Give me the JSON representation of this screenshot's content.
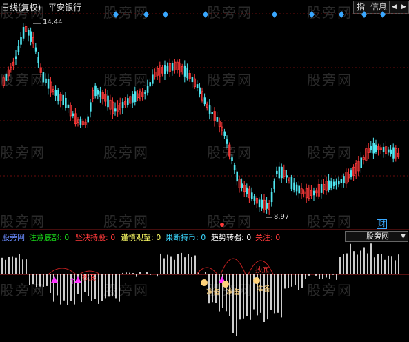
{
  "header": {
    "period": "日线(复权)",
    "stock": "平安银行",
    "btn_index": "指",
    "btn_info": "信息",
    "btn_prev": "◀",
    "btn_next": "▶"
  },
  "price_chart": {
    "high_label": "14.44",
    "low_label": "8.97",
    "finance_badge": "财"
  },
  "indicator_bar": {
    "source": "股旁网",
    "items": [
      {
        "label": "注意底部",
        "value": "0",
        "color": "#19d819"
      },
      {
        "label": "坚决持股",
        "value": "0",
        "color": "#ff3a3a"
      },
      {
        "label": "谨慎观望",
        "value": "0",
        "color": "#ffff66"
      },
      {
        "label": "果断持币",
        "value": "0",
        "color": "#3ad8ff"
      },
      {
        "label": "趋势转强",
        "value": "0",
        "color": "#ffffff"
      },
      {
        "label": "关注",
        "value": "0",
        "color": "#ff3a3a"
      }
    ],
    "dropdown": "股旁网"
  },
  "signals": {
    "label_zhundi": "抄底",
    "label_zhunbei": "准备",
    "label_up": "↑"
  },
  "watermark": "股旁网",
  "colors": {
    "up": "#ff3a3a",
    "down": "#4fe6f0",
    "signal_diamond": "#3aa8ff",
    "magenta": "#ff33ff",
    "gold": "#ffd27a"
  }
}
